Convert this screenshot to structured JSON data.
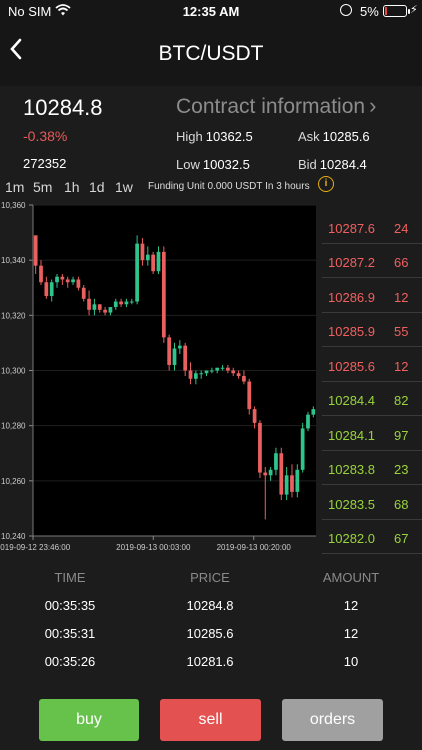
{
  "status_bar": {
    "carrier": "No SIM",
    "time": "12:35 AM",
    "battery": "5%"
  },
  "header": {
    "title": "BTC/USDT"
  },
  "summary": {
    "last_price": "10284.8",
    "change": "-0.38%",
    "volume": "272352",
    "contract_link": "Contract information",
    "high_label": "High",
    "high": "10362.5",
    "low_label": "Low",
    "low": "10032.5",
    "ask_label": "Ask",
    "ask": "10285.6",
    "bid_label": "Bid",
    "bid": "10284.4"
  },
  "timeframes": [
    "1m",
    "5m",
    "1h",
    "1d",
    "1w"
  ],
  "funding": {
    "text": "Funding Unit 0.000 USDT In   3 hours"
  },
  "colors": {
    "up": "#2ec48c",
    "down": "#e9605f",
    "ask": "#f0605f",
    "bid": "#9ad43c",
    "buy": "#67c24c",
    "sell": "#e35250",
    "orders": "#a0a0a0"
  },
  "chart_data": {
    "type": "candlestick",
    "y_ticks": [
      "10,360",
      "10,340",
      "10,320",
      "10,300",
      "10,280",
      "10,260",
      "10,240"
    ],
    "ylim": [
      10240,
      10360
    ],
    "x_ticks": [
      "2019-09-12 23:46:00",
      "2019-09-13 00:03:00",
      "2019-09-13 00:20:00"
    ],
    "candles": [
      [
        10349,
        10349,
        10335,
        10338
      ],
      [
        10338,
        10340,
        10331,
        10332
      ],
      [
        10332,
        10334,
        10326,
        10327
      ],
      [
        10327,
        10333,
        10325,
        10332
      ],
      [
        10332,
        10335,
        10330,
        10334
      ],
      [
        10334,
        10335,
        10331,
        10333
      ],
      [
        10333,
        10334,
        10330,
        10332
      ],
      [
        10332,
        10334,
        10331,
        10333
      ],
      [
        10333,
        10334,
        10329,
        10330
      ],
      [
        10330,
        10331,
        10325,
        10326
      ],
      [
        10326,
        10329,
        10320,
        10322
      ],
      [
        10322,
        10326,
        10320,
        10324
      ],
      [
        10324,
        10324,
        10321,
        10322
      ],
      [
        10322,
        10323,
        10320,
        10321
      ],
      [
        10321,
        10323,
        10320,
        10323
      ],
      [
        10323,
        10326,
        10322,
        10325
      ],
      [
        10325,
        10326,
        10323,
        10324
      ],
      [
        10324,
        10326,
        10323,
        10325
      ],
      [
        10325,
        10326,
        10324,
        10325
      ],
      [
        10325,
        10349,
        10324,
        10346
      ],
      [
        10346,
        10348,
        10338,
        10340
      ],
      [
        10340,
        10345,
        10338,
        10342
      ],
      [
        10342,
        10343,
        10335,
        10336
      ],
      [
        10336,
        10345,
        10335,
        10343
      ],
      [
        10343,
        10345,
        10310,
        10312
      ],
      [
        10312,
        10313,
        10300,
        10302
      ],
      [
        10302,
        10310,
        10300,
        10308
      ],
      [
        10308,
        10311,
        10306,
        10309
      ],
      [
        10309,
        10310,
        10298,
        10300
      ],
      [
        10300,
        10303,
        10295,
        10297
      ],
      [
        10297,
        10300,
        10295,
        10299
      ],
      [
        10299,
        10300,
        10297,
        10299
      ],
      [
        10299,
        10300,
        10298,
        10300
      ],
      [
        10300,
        10301,
        10299,
        10300
      ],
      [
        10300,
        10301,
        10299,
        10301
      ],
      [
        10301,
        10302,
        10300,
        10301
      ],
      [
        10301,
        10302,
        10299,
        10300
      ],
      [
        10300,
        10301,
        10298,
        10299
      ],
      [
        10299,
        10300,
        10297,
        10298
      ],
      [
        10298,
        10300,
        10295,
        10296
      ],
      [
        10296,
        10297,
        10284,
        10286
      ],
      [
        10286,
        10287,
        10279,
        10281
      ],
      [
        10281,
        10282,
        10261,
        10263
      ],
      [
        10263,
        10265,
        10246,
        10262
      ],
      [
        10262,
        10265,
        10260,
        10264
      ],
      [
        10264,
        10272,
        10262,
        10270
      ],
      [
        10270,
        10272,
        10253,
        10255
      ],
      [
        10255,
        10265,
        10253,
        10262
      ],
      [
        10262,
        10266,
        10254,
        10256
      ],
      [
        10256,
        10266,
        10254,
        10264
      ],
      [
        10264,
        10281,
        10263,
        10279
      ],
      [
        10279,
        10285,
        10278,
        10284
      ],
      [
        10284,
        10287,
        10283,
        10286
      ]
    ]
  },
  "orderbook": {
    "asks": [
      {
        "price": "10287.6",
        "amount": "24"
      },
      {
        "price": "10287.2",
        "amount": "66"
      },
      {
        "price": "10286.9",
        "amount": "12"
      },
      {
        "price": "10285.9",
        "amount": "55"
      },
      {
        "price": "10285.6",
        "amount": "12"
      }
    ],
    "bids": [
      {
        "price": "10284.4",
        "amount": "82"
      },
      {
        "price": "10284.1",
        "amount": "97"
      },
      {
        "price": "10283.8",
        "amount": "23"
      },
      {
        "price": "10283.5",
        "amount": "68"
      },
      {
        "price": "10282.0",
        "amount": "67"
      }
    ]
  },
  "trades": {
    "headers": [
      "TIME",
      "PRICE",
      "AMOUNT"
    ],
    "rows": [
      [
        "00:35:35",
        "10284.8",
        "12"
      ],
      [
        "00:35:31",
        "10285.6",
        "12"
      ],
      [
        "00:35:26",
        "10281.6",
        "10"
      ]
    ]
  },
  "actions": {
    "buy": "buy",
    "sell": "sell",
    "orders": "orders"
  }
}
